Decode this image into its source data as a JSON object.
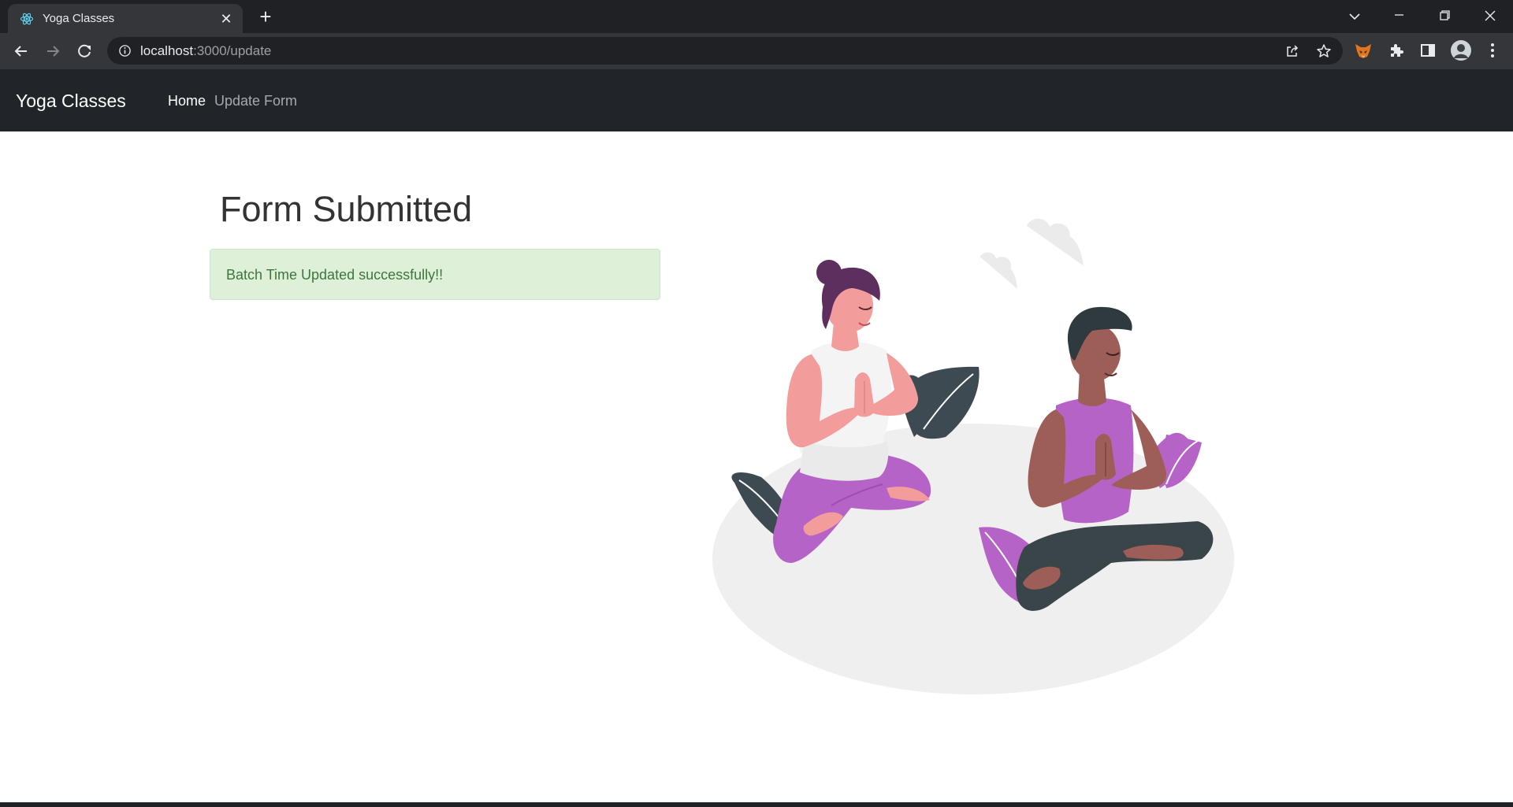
{
  "browser": {
    "tab": {
      "title": "Yoga Classes",
      "favicon": "react-icon"
    },
    "address": {
      "host": "localhost",
      "path": ":3000/update"
    },
    "controls": [
      "back-icon",
      "forward-icon",
      "reload-icon",
      "share-icon",
      "bookmark-star-icon",
      "fox-extension-icon",
      "puzzle-extensions-icon",
      "side-panel-icon",
      "profile-avatar",
      "kebab-menu-icon"
    ]
  },
  "navbar": {
    "brand": "Yoga Classes",
    "links": [
      {
        "label": "Home",
        "active": true
      },
      {
        "label": "Update Form",
        "active": false
      }
    ]
  },
  "main": {
    "title": "Form Submitted",
    "alert": {
      "message": "Batch Time Updated successfully!!",
      "type": "success"
    },
    "illustration": "two-people-meditating-yoga"
  },
  "colors": {
    "navbar_bg": "#212529",
    "alert_bg": "#dff0d8",
    "alert_text": "#3c763d",
    "accent_purple": "#b663c8"
  }
}
